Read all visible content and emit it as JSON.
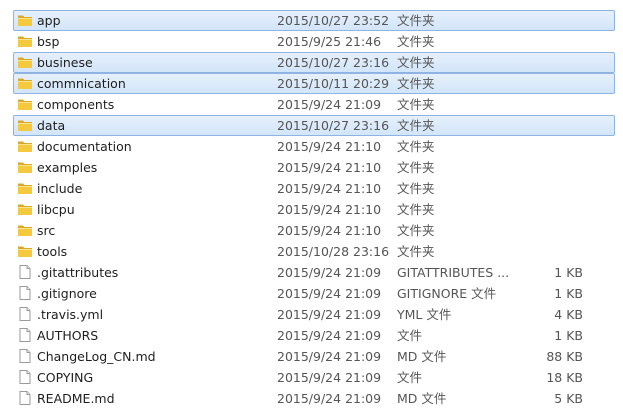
{
  "files": [
    {
      "name": "app",
      "date": "2015/10/27 23:52",
      "type": "文件夹",
      "size": "",
      "icon": "folder-icon",
      "selected": true
    },
    {
      "name": "bsp",
      "date": "2015/9/25 21:46",
      "type": "文件夹",
      "size": "",
      "icon": "folder-icon",
      "selected": false
    },
    {
      "name": "businese",
      "date": "2015/10/27 23:16",
      "type": "文件夹",
      "size": "",
      "icon": "folder-icon",
      "selected": true
    },
    {
      "name": "commnication",
      "date": "2015/10/11 20:29",
      "type": "文件夹",
      "size": "",
      "icon": "folder-icon",
      "selected": true
    },
    {
      "name": "components",
      "date": "2015/9/24 21:09",
      "type": "文件夹",
      "size": "",
      "icon": "folder-icon",
      "selected": false
    },
    {
      "name": "data",
      "date": "2015/10/27 23:16",
      "type": "文件夹",
      "size": "",
      "icon": "folder-icon",
      "selected": true
    },
    {
      "name": "documentation",
      "date": "2015/9/24 21:10",
      "type": "文件夹",
      "size": "",
      "icon": "folder-icon",
      "selected": false
    },
    {
      "name": "examples",
      "date": "2015/9/24 21:10",
      "type": "文件夹",
      "size": "",
      "icon": "folder-icon",
      "selected": false
    },
    {
      "name": "include",
      "date": "2015/9/24 21:10",
      "type": "文件夹",
      "size": "",
      "icon": "folder-icon",
      "selected": false
    },
    {
      "name": "libcpu",
      "date": "2015/9/24 21:10",
      "type": "文件夹",
      "size": "",
      "icon": "folder-icon",
      "selected": false
    },
    {
      "name": "src",
      "date": "2015/9/24 21:10",
      "type": "文件夹",
      "size": "",
      "icon": "folder-icon",
      "selected": false
    },
    {
      "name": "tools",
      "date": "2015/10/28 23:16",
      "type": "文件夹",
      "size": "",
      "icon": "folder-icon",
      "selected": false
    },
    {
      "name": ".gitattributes",
      "date": "2015/9/24 21:09",
      "type": "GITATTRIBUTES ...",
      "size": "1 KB",
      "icon": "file-icon",
      "selected": false
    },
    {
      "name": ".gitignore",
      "date": "2015/9/24 21:09",
      "type": "GITIGNORE 文件",
      "size": "1 KB",
      "icon": "file-icon",
      "selected": false
    },
    {
      "name": ".travis.yml",
      "date": "2015/9/24 21:09",
      "type": "YML 文件",
      "size": "4 KB",
      "icon": "file-icon",
      "selected": false
    },
    {
      "name": "AUTHORS",
      "date": "2015/9/24 21:09",
      "type": "文件",
      "size": "1 KB",
      "icon": "file-icon",
      "selected": false
    },
    {
      "name": "ChangeLog_CN.md",
      "date": "2015/9/24 21:09",
      "type": "MD 文件",
      "size": "88 KB",
      "icon": "file-icon",
      "selected": false
    },
    {
      "name": "COPYING",
      "date": "2015/9/24 21:09",
      "type": "文件",
      "size": "18 KB",
      "icon": "file-icon",
      "selected": false
    },
    {
      "name": "README.md",
      "date": "2015/9/24 21:09",
      "type": "MD 文件",
      "size": "5 KB",
      "icon": "file-icon",
      "selected": false
    }
  ]
}
